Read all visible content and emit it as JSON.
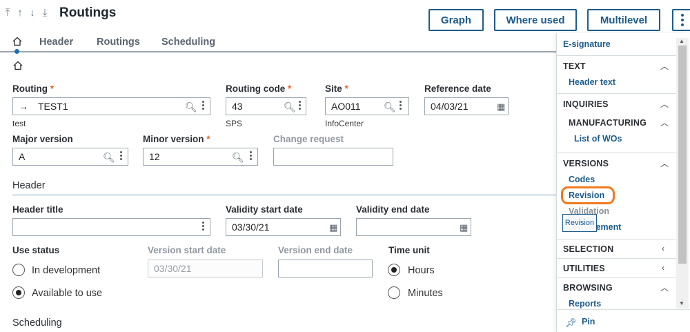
{
  "header": {
    "title": "Routings",
    "buttons": {
      "graph": "Graph",
      "where_used": "Where used",
      "multilevel": "Multilevel"
    }
  },
  "tabs": [
    "Header",
    "Routings",
    "Scheduling"
  ],
  "fields": {
    "routing": {
      "label": "Routing",
      "value": "TEST1",
      "sub": "test"
    },
    "routing_code": {
      "label": "Routing code",
      "value": "43",
      "sub": "SPS"
    },
    "site": {
      "label": "Site",
      "value": "AO011",
      "sub": "InfoCenter"
    },
    "reference_date": {
      "label": "Reference date",
      "value": "04/03/21"
    },
    "major_version": {
      "label": "Major version",
      "value": "A"
    },
    "minor_version": {
      "label": "Minor version",
      "value": "12"
    },
    "change_request": {
      "label": "Change request",
      "value": ""
    }
  },
  "header_section": {
    "title": "Header",
    "header_title": {
      "label": "Header title",
      "value": ""
    },
    "validity_start": {
      "label": "Validity start date",
      "value": "03/30/21"
    },
    "validity_end": {
      "label": "Validity end date",
      "value": ""
    },
    "use_status": {
      "label": "Use status",
      "options": [
        "In development",
        "Available to use"
      ],
      "selected": "Available to use"
    },
    "version_start": {
      "label": "Version start date",
      "value": "03/30/21"
    },
    "version_end": {
      "label": "Version end date",
      "value": ""
    },
    "time_unit": {
      "label": "Time unit",
      "options": [
        "Hours",
        "Minutes"
      ],
      "selected": "Hours"
    }
  },
  "scheduling_section": {
    "title": "Scheduling"
  },
  "panel": {
    "esignature": "E-signature",
    "text": {
      "title": "TEXT",
      "items": [
        "Header text"
      ]
    },
    "inquiries": {
      "title": "INQUIRIES",
      "manufacturing": "MANUFACTURING",
      "items": [
        "List of WOs"
      ]
    },
    "versions": {
      "title": "VERSIONS",
      "items": [
        "Codes",
        "Revision",
        "Validation",
        "Management"
      ]
    },
    "selection": "SELECTION",
    "utilities": "UTILITIES",
    "browsing": {
      "title": "BROWSING",
      "items": [
        "Reports"
      ]
    },
    "pin": "Pin",
    "tooltip": "Revision"
  },
  "colors": {
    "accent": "#1c5c8c",
    "required": "#e8632a",
    "highlight": "#f07a1c"
  }
}
